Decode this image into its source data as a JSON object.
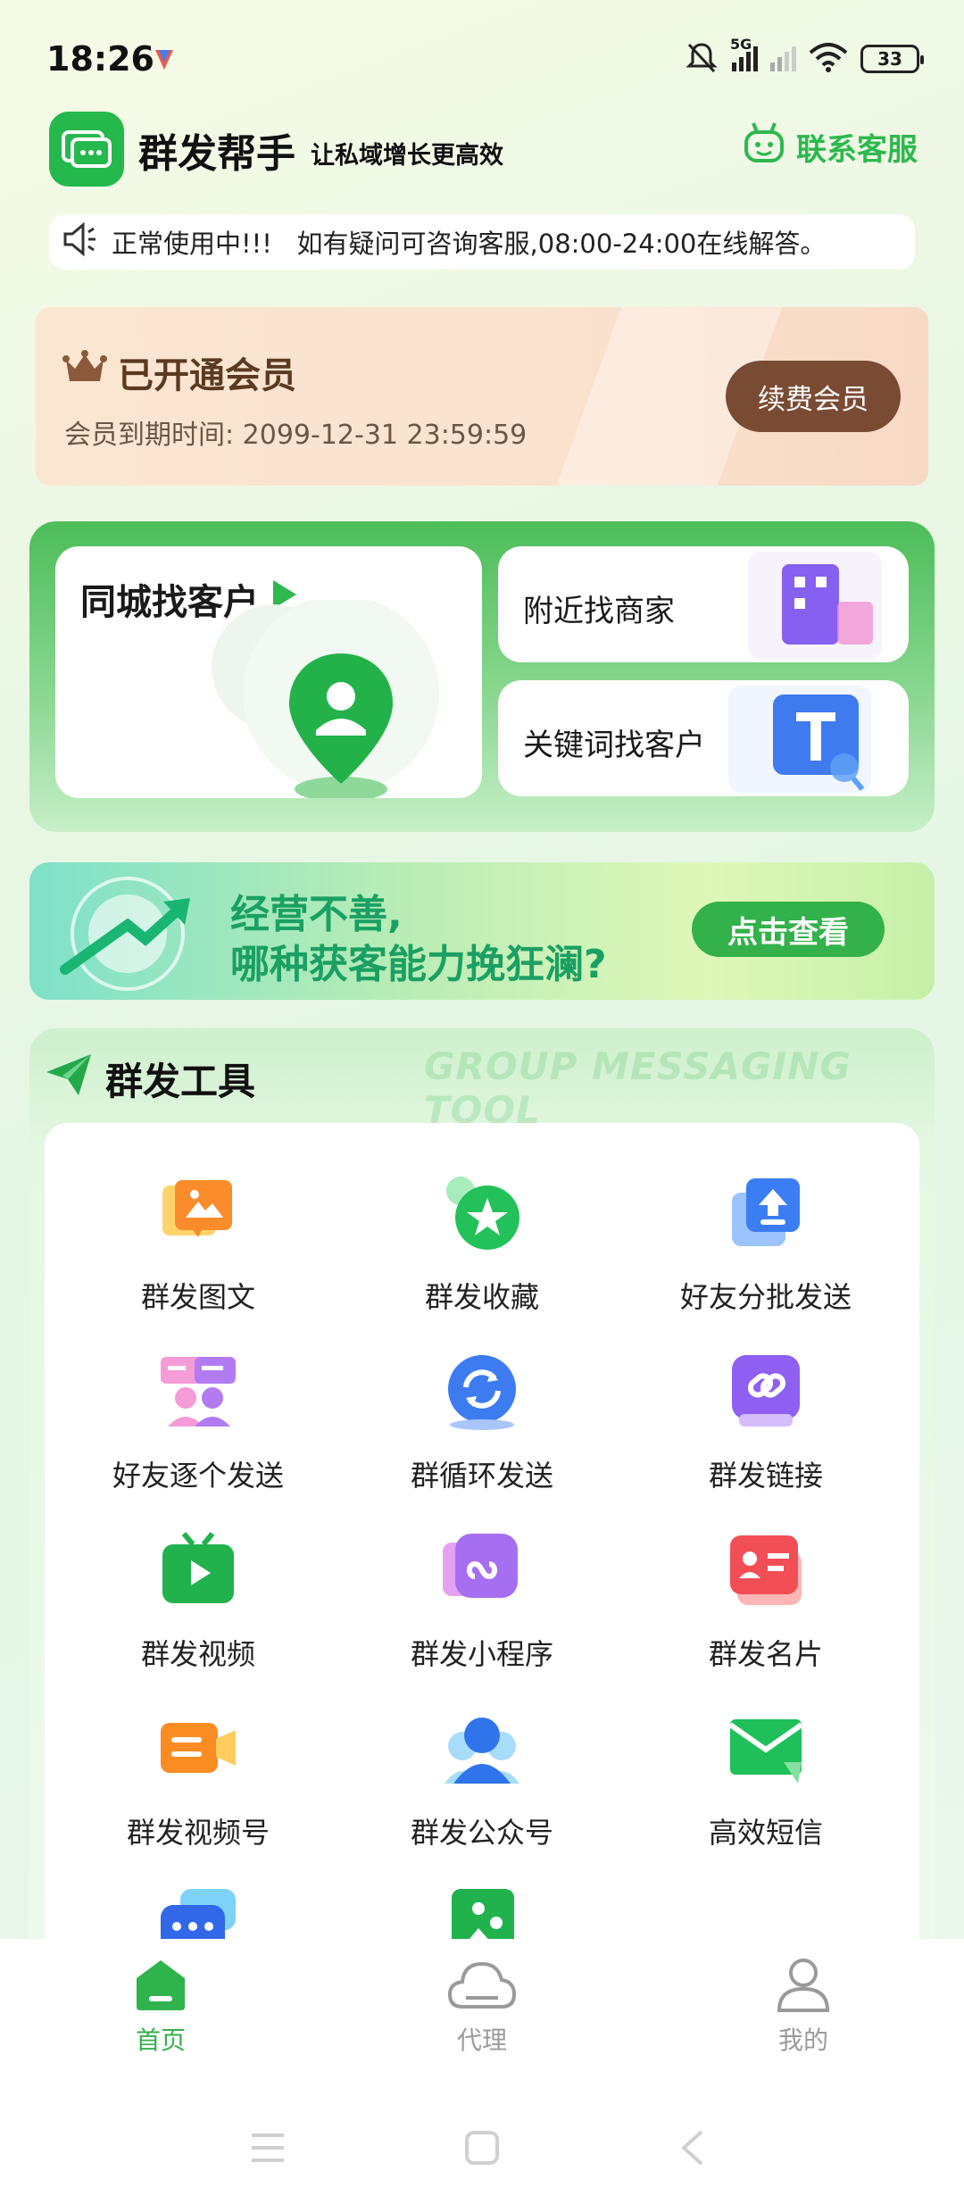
{
  "status_bar": {
    "time": "18:26",
    "network": "5G",
    "battery": "33"
  },
  "header": {
    "app_name": "群发帮手",
    "slogan": "让私域增长更高效",
    "contact_label": "联系客服"
  },
  "notice": {
    "text": "正常使用中!!!   如有疑问可咨询客服,08:00-24:00在线解答。"
  },
  "membership": {
    "title": "已开通会员",
    "expire_text": "会员到期时间: 2099-12-31 23:59:59",
    "renew_label": "续费会员"
  },
  "find": {
    "local_title": "同城找客户",
    "nearby_label": "附近找商家",
    "keyword_label": "关键词找客户"
  },
  "banner": {
    "line1": "经营不善,",
    "line2": "哪种获客能力挽狂澜?",
    "button": "点击查看"
  },
  "tools": {
    "title": "群发工具",
    "watermark": "GROUP MESSAGING TOOL",
    "items": [
      {
        "label": "群发图文",
        "icon": "image-text-icon"
      },
      {
        "label": "群发收藏",
        "icon": "star-icon"
      },
      {
        "label": "好友分批发送",
        "icon": "batch-send-icon"
      },
      {
        "label": "好友逐个发送",
        "icon": "one-by-one-icon"
      },
      {
        "label": "群循环发送",
        "icon": "loop-icon"
      },
      {
        "label": "群发链接",
        "icon": "link-icon"
      },
      {
        "label": "群发视频",
        "icon": "video-icon"
      },
      {
        "label": "群发小程序",
        "icon": "mini-program-icon"
      },
      {
        "label": "群发名片",
        "icon": "business-card-icon"
      },
      {
        "label": "群发视频号",
        "icon": "video-channel-icon"
      },
      {
        "label": "群发公众号",
        "icon": "official-account-icon"
      },
      {
        "label": "高效短信",
        "icon": "sms-icon"
      }
    ]
  },
  "nav": {
    "home": "首页",
    "agent": "代理",
    "mine": "我的"
  },
  "colors": {
    "brand_green": "#2eb84e",
    "member_brown": "#7a4b33",
    "nav_active": "#33b14a",
    "nav_inactive": "#9a9a9a"
  }
}
